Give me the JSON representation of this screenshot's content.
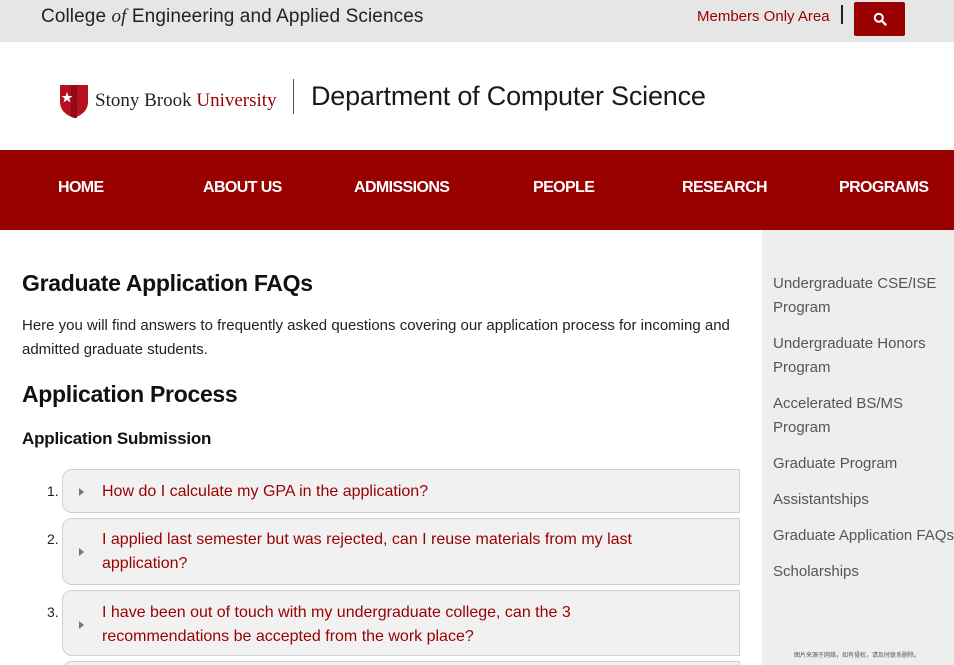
{
  "topbar": {
    "college_pre": "College",
    "college_of": "of",
    "college_post": "Engineering and Applied Sciences",
    "members_link": "Members Only Area",
    "search_icon": "search-icon"
  },
  "header": {
    "university_name_part1": "Stony Brook",
    "university_name_part2": "University",
    "department": "Department of Computer Science",
    "logo_icon": "star-shield-icon"
  },
  "nav": {
    "items": [
      "HOME",
      "ABOUT US",
      "ADMISSIONS",
      "PEOPLE",
      "RESEARCH",
      "PROGRAMS"
    ]
  },
  "main": {
    "title": "Graduate Application FAQs",
    "intro": "Here you will find answers to frequently asked questions covering our application process for incoming and admitted graduate students.",
    "section_title": "Application Process",
    "subsection_title": "Application Submission",
    "faqs": [
      {
        "num": "1.",
        "question": "How do I calculate my GPA in the application?"
      },
      {
        "num": "2.",
        "question": "I applied last semester but was rejected, can I reuse materials from my last application?"
      },
      {
        "num": "3.",
        "question": "I have been out of touch with my undergraduate college, can the 3 recommendations be accepted from the work place?"
      }
    ]
  },
  "sidebar": {
    "links": [
      "Undergraduate CSE/ISE Program",
      "Undergraduate Honors Program",
      "Accelerated BS/MS Program",
      "Graduate Program",
      "Assistantships",
      "Graduate Application FAQs",
      "Scholarships"
    ],
    "footnote": "图片来源于网络，如有侵权，请及时联系删除。"
  },
  "colors": {
    "brand_red": "#990000",
    "topbar_bg": "#e6e6e6",
    "sidebar_bg": "#eeeeee"
  }
}
